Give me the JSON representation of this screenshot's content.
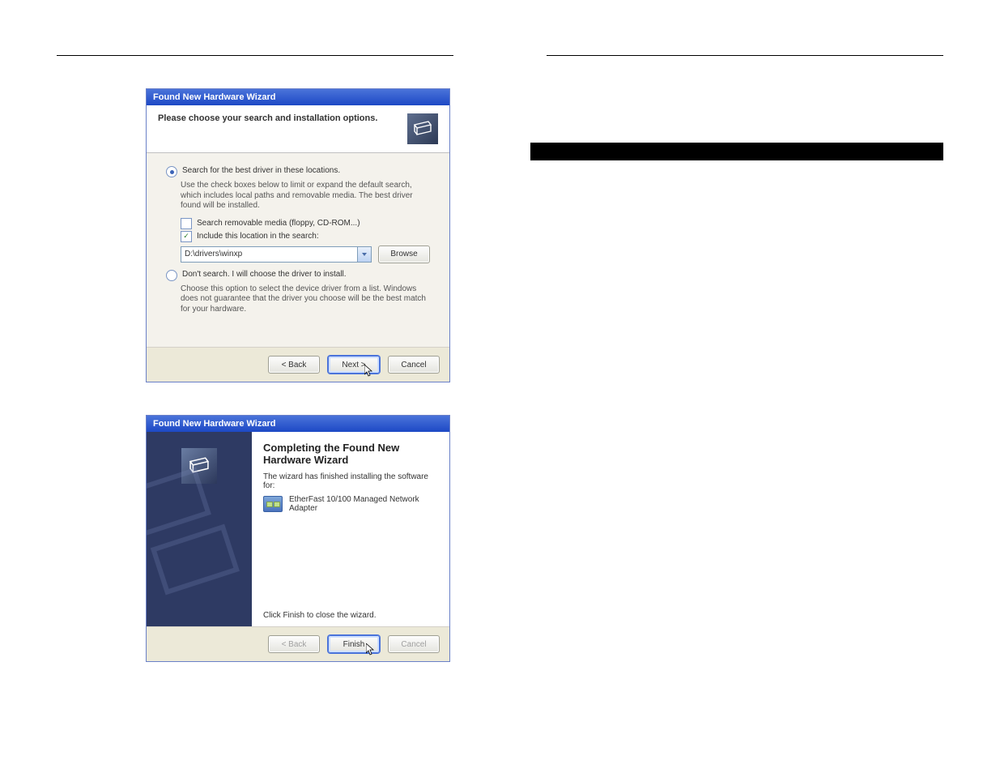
{
  "page_left": {
    "header_left": "",
    "header_right": "",
    "number": ""
  },
  "page_right": {
    "header_left": "",
    "header_right": "",
    "number": "",
    "black_bar": " ",
    "body_text": ""
  },
  "wiz1": {
    "title": "Found New Hardware Wizard",
    "header": "Please choose your search and installation options.",
    "radio_search": {
      "label": "Search for the best driver in these locations.",
      "checked": true
    },
    "search_help": "Use the check boxes below to limit or expand the default search, which includes local paths and removable media. The best driver found will be installed.",
    "chk_removable": {
      "label": "Search removable media (floppy, CD-ROM...)",
      "checked": false
    },
    "chk_include_location": {
      "label": "Include this location in the search:",
      "checked": true
    },
    "path_value": "D:\\drivers\\winxp",
    "browse_label": "Browse",
    "radio_nosearch": {
      "label": "Don't search. I will choose the driver to install.",
      "checked": false
    },
    "nosearch_help": "Choose this option to select the device driver from a list.  Windows does not guarantee that the driver you choose will be the best match for your hardware.",
    "btn_back": "< Back",
    "btn_next": "Next >",
    "btn_cancel": "Cancel"
  },
  "wiz2": {
    "title": "Found New Hardware Wizard",
    "heading": "Completing the Found New Hardware Wizard",
    "subline": "The wizard has finished installing the software for:",
    "device_name": "EtherFast 10/100 Managed Network Adapter",
    "closing": "Click Finish to close the wizard.",
    "btn_back": "< Back",
    "btn_finish": "Finish",
    "btn_cancel": "Cancel"
  }
}
